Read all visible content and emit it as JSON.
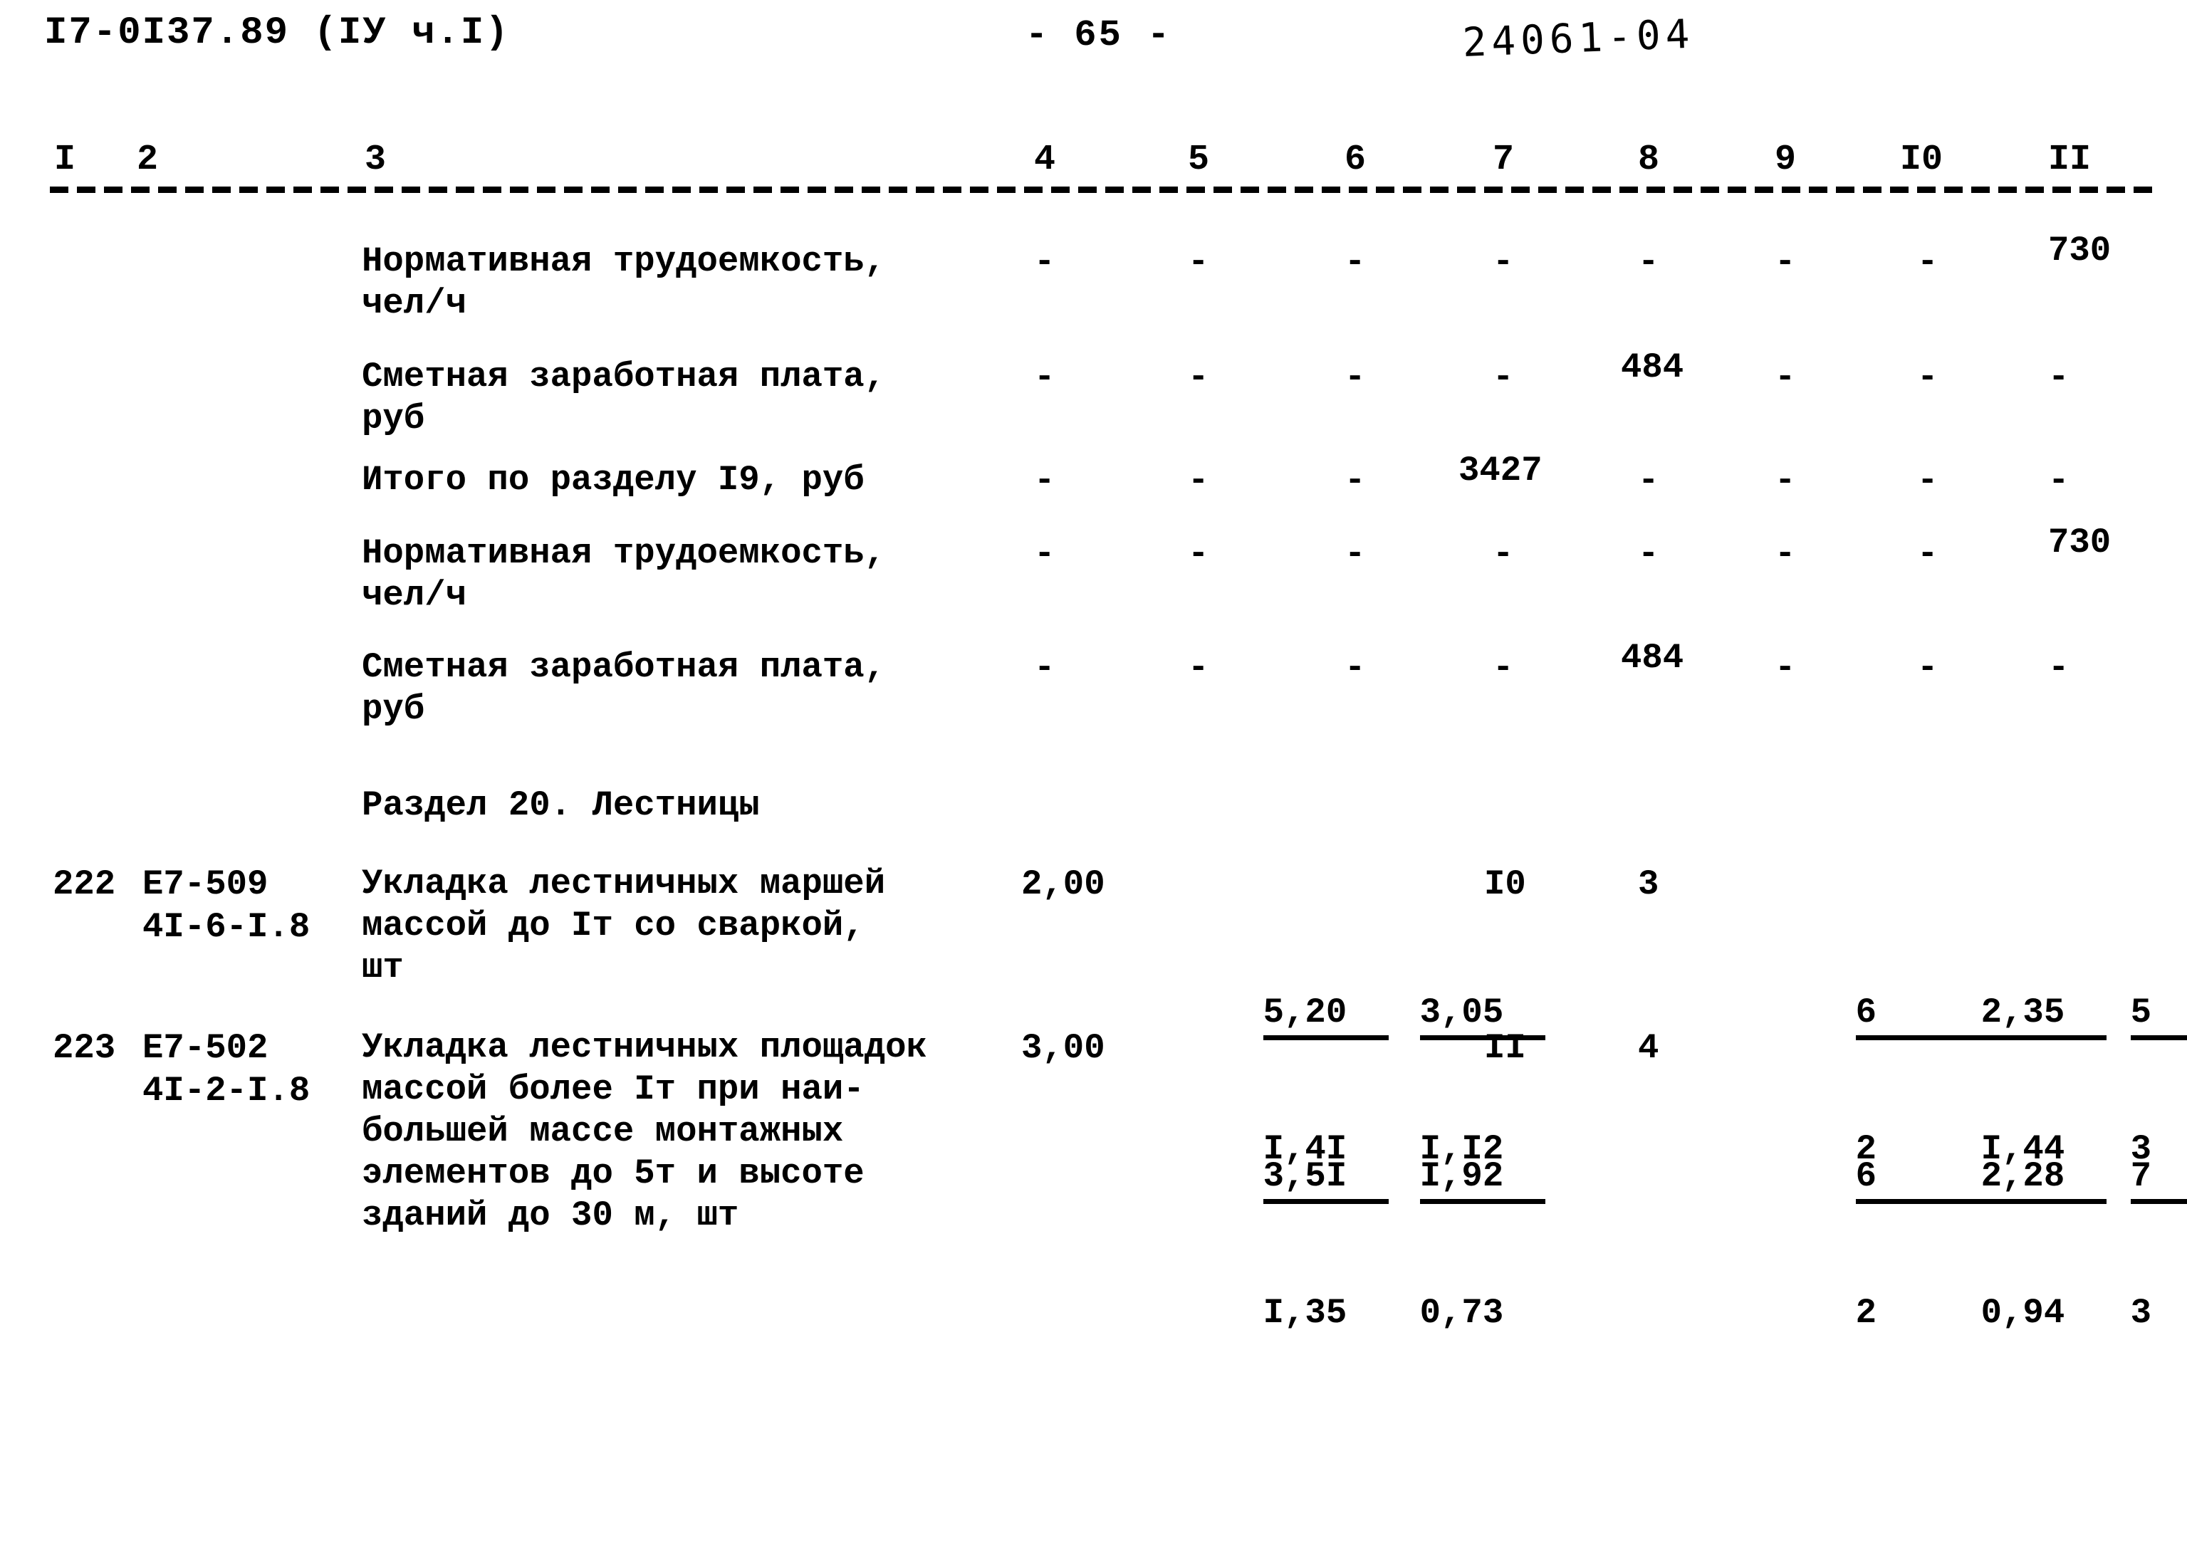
{
  "header": {
    "doc_code": "I7-0I37.89 (IУ ч.I)",
    "page_number": "- 65 -",
    "hand_note": "24061-04"
  },
  "column_headers": [
    "I",
    "2",
    "3",
    "4",
    "5",
    "6",
    "7",
    "8",
    "9",
    "I0",
    "II"
  ],
  "rows": [
    {
      "kind": "summary",
      "no": "",
      "code1": "",
      "code2": "",
      "desc": [
        "Нормативная трудоемкость,",
        "чел/ч"
      ],
      "c4": "-",
      "c5": "-",
      "c6": "-",
      "c7": "-",
      "c8": "-",
      "c9": "-",
      "c10": "-",
      "c11": "730"
    },
    {
      "kind": "summary",
      "no": "",
      "code1": "",
      "code2": "",
      "desc": [
        "Сметная заработная плата,",
        "руб"
      ],
      "c4": "-",
      "c5": "-",
      "c6": "-",
      "c7": "-",
      "c8": "484",
      "c9": "-",
      "c10": "-",
      "c11": "-"
    },
    {
      "kind": "summary",
      "no": "",
      "code1": "",
      "code2": "",
      "desc": [
        "Итого по разделу I9, руб"
      ],
      "c4": "-",
      "c5": "-",
      "c6": "-",
      "c7": "3427",
      "c8": "-",
      "c9": "-",
      "c10": "-",
      "c11": "-"
    },
    {
      "kind": "summary",
      "no": "",
      "code1": "",
      "code2": "",
      "desc": [
        "Нормативная трудоемкость,",
        "чел/ч"
      ],
      "c4": "-",
      "c5": "-",
      "c6": "-",
      "c7": "-",
      "c8": "-",
      "c9": "-",
      "c10": "-",
      "c11": "730"
    },
    {
      "kind": "summary",
      "no": "",
      "code1": "",
      "code2": "",
      "desc": [
        "Сметная заработная плата,",
        "руб"
      ],
      "c4": "-",
      "c5": "-",
      "c6": "-",
      "c7": "-",
      "c8": "484",
      "c9": "-",
      "c10": "-",
      "c11": "-"
    }
  ],
  "section_title": "Раздел 20. Лестницы",
  "item_rows": [
    {
      "no": "222",
      "code1": "Е7-509",
      "code2": "4I-6-I.8",
      "desc": [
        "Укладка лестничных маршей",
        "массой до Iт со сваркой,",
        "шт"
      ],
      "c4": "2,00",
      "c5": {
        "top": "5,20",
        "bot": "I,4I"
      },
      "c6": {
        "top": "3,05",
        "bot": "I,I2"
      },
      "c7": "I0",
      "c8": "3",
      "c9": {
        "top": "6",
        "bot": "2"
      },
      "c10": {
        "top": "2,35",
        "bot": "I,44"
      },
      "c11": {
        "top": "5",
        "bot": "3"
      }
    },
    {
      "no": "223",
      "code1": "Е7-502",
      "code2": "4I-2-I.8",
      "desc": [
        "Укладка лестничных площадок",
        "массой более Iт при наи-",
        "большей массе монтажных",
        "элементов до 5т и высоте",
        "зданий до 30 м, шт"
      ],
      "c4": "3,00",
      "c5": {
        "top": "3,5I",
        "bot": "I,35"
      },
      "c6": {
        "top": "I,92",
        "bot": "0,73"
      },
      "c7": "II",
      "c8": "4",
      "c9": {
        "top": "6",
        "bot": "2"
      },
      "c10": {
        "top": "2,28",
        "bot": "0,94"
      },
      "c11": {
        "top": "7",
        "bot": "3"
      }
    }
  ]
}
